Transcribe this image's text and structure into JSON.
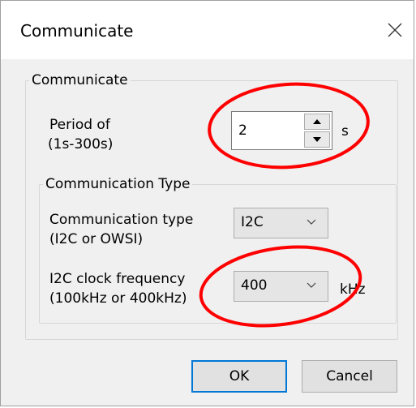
{
  "window": {
    "title": "Communicate",
    "close_icon": "close-icon"
  },
  "group_communicate": {
    "legend": "Communicate",
    "period_label_line1": "Period of",
    "period_label_line2": "(1s-300s)",
    "period_value": "2",
    "period_unit": "s"
  },
  "group_type": {
    "legend": "Communication Type",
    "type_label_line1": "Communication type",
    "type_label_line2": "(I2C or OWSI)",
    "type_selected": "I2C",
    "freq_label_line1": "I2C clock frequency",
    "freq_label_line2": "(100kHz or 400kHz)",
    "freq_selected": "400",
    "freq_unit": "kHz"
  },
  "buttons": {
    "ok": "OK",
    "cancel": "Cancel"
  },
  "colors": {
    "annotation_circle": "#ff0000",
    "default_button_border": "#0078d7"
  }
}
